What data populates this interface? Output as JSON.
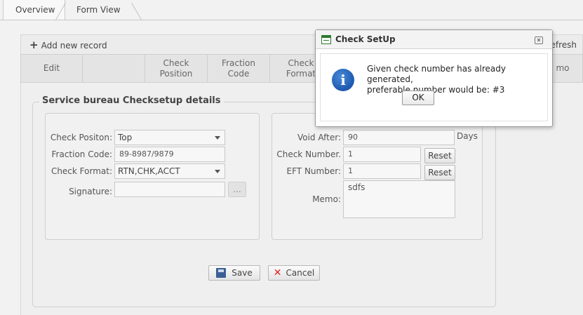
{
  "tabs": [
    {
      "label": "Overview",
      "active": true
    },
    {
      "label": "Form View",
      "active": false
    }
  ],
  "toolbar": {
    "add_label": "Add new record",
    "refresh_label": "efresh"
  },
  "columns": [
    "Edit",
    "",
    "Check Position",
    "Fraction Code",
    "Check Format",
    "mo"
  ],
  "form": {
    "legend": "Service bureau Checksetup details",
    "check_position": {
      "label": "Check Positon:",
      "value": "Top"
    },
    "fraction_code": {
      "label": "Fraction Code:",
      "value": "89-8987/9879"
    },
    "check_format": {
      "label": "Check Format:",
      "value": "RTN,CHK,ACCT"
    },
    "signature": {
      "label": "Signature:",
      "value": "",
      "browse_label": "..."
    },
    "void_after": {
      "label": "Void After:",
      "value": "90",
      "unit": "Days"
    },
    "check_number": {
      "label": "Check Number.",
      "value": "1",
      "reset_label": "Reset"
    },
    "eft_number": {
      "label": "EFT Number:",
      "value": "1",
      "reset_label": "Reset"
    },
    "memo": {
      "label": "Memo:",
      "value": "sdfs"
    },
    "save_label": "Save",
    "cancel_label": "Cancel"
  },
  "dialog": {
    "title": "Check SetUp",
    "message_line1": "Given check number has already generated,",
    "message_line2": "preferable number would be: #3",
    "ok_label": "OK",
    "close_glyph": "✕",
    "info_glyph": "i"
  },
  "icons": {
    "add": "plus-icon",
    "save": "floppy-disk-icon",
    "cancel": "x-icon",
    "dialog_info": "info-icon",
    "dialog_title": "window-form-icon",
    "dropdown": "chevron-down-icon"
  }
}
